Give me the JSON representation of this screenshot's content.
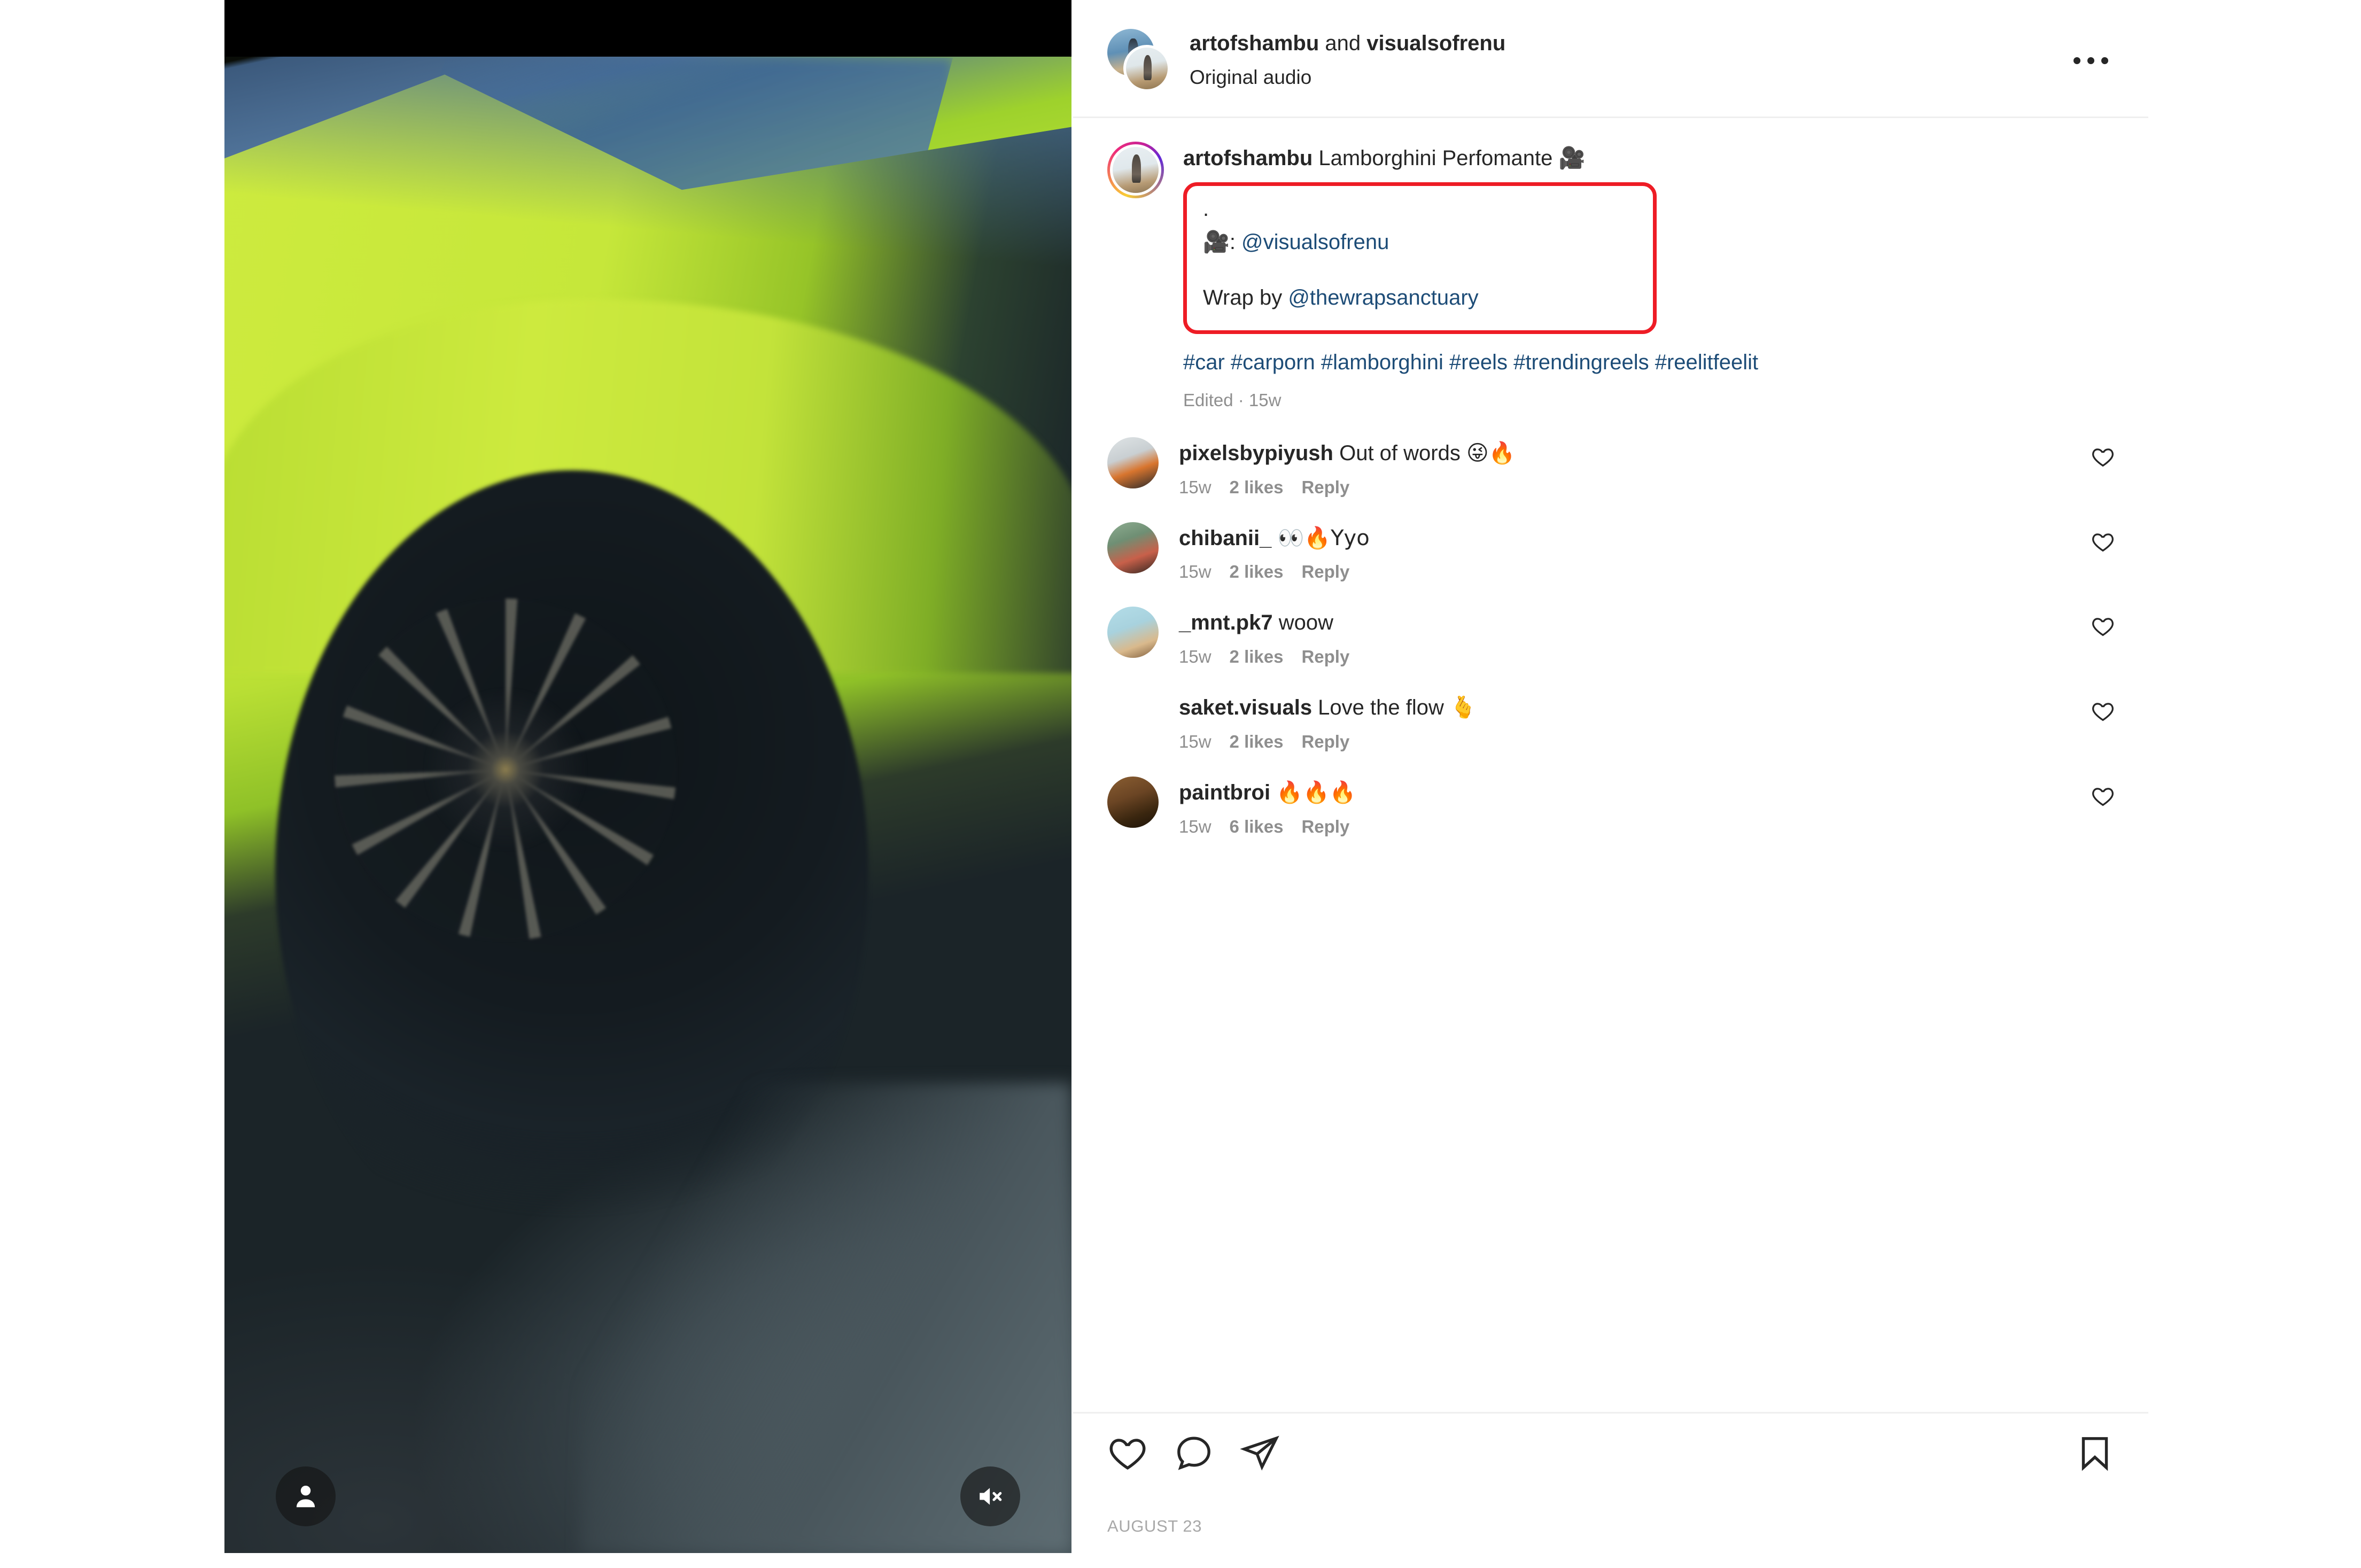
{
  "header": {
    "usernames": "artofshambu and visualsofrenu",
    "primary_user": "artofshambu",
    "secondary_user": "visualsofrenu",
    "connector": " and ",
    "audio": "Original audio",
    "more_icon": "more-options-icon"
  },
  "media": {
    "type": "video",
    "tag_icon": "person-tag-icon",
    "mute_icon": "speaker-muted-icon"
  },
  "caption": {
    "username": "artofshambu",
    "text": " Lamborghini Perfomante ",
    "emoji": "🎥",
    "boxed": {
      "dot": ".",
      "credit_emoji": "🎥",
      "credit_sep": ": ",
      "credit_mention": "@visualsofrenu",
      "wrap_prefix": "Wrap by ",
      "wrap_mention": "@thewrapsanctuary"
    },
    "hashtags": "#car #carporn #lamborghini #reels #trendingreels #reelitfeelit",
    "meta": "Edited · 15w",
    "annotation_color": "#ee1c25",
    "link_color": "#1d4c77"
  },
  "comments": [
    {
      "username": "pixelsbypiyush",
      "text": " Out of words ",
      "emoji": "😜🔥",
      "time": "15w",
      "likes": "2 likes",
      "reply": "Reply",
      "avatar_from": "#e8eaec",
      "avatar_to": "#d86b2a",
      "like_icon": "heart-icon"
    },
    {
      "username": "chibanii_",
      "text": " ",
      "emoji": "👀🔥Yyo",
      "time": "15w",
      "likes": "2 likes",
      "reply": "Reply",
      "avatar_from": "#7f9d86",
      "avatar_to": "#c8604a",
      "like_icon": "heart-icon"
    },
    {
      "username": "_mnt.pk7",
      "text": " woow",
      "emoji": "",
      "time": "15w",
      "likes": "2 likes",
      "reply": "Reply",
      "avatar_from": "#aedbe6",
      "avatar_to": "#d9b98c",
      "like_icon": "heart-icon"
    },
    {
      "username": "saket.visuals",
      "text": " Love the flow ",
      "emoji": "🫰",
      "time": "15w",
      "likes": "2 likes",
      "reply": "Reply",
      "avatar_from": "#e6cdb4",
      "avatar_to": "#8a6a4a",
      "like_icon": "heart-icon"
    },
    {
      "username": "paintbroi",
      "text": " ",
      "emoji": "🔥🔥🔥",
      "time": "15w",
      "likes": "6 likes",
      "reply": "Reply",
      "avatar_from": "#6e4a2a",
      "avatar_to": "#2a1c10",
      "like_icon": "heart-icon"
    }
  ],
  "actions": {
    "like_icon": "heart-icon",
    "comment_icon": "comment-bubble-icon",
    "share_icon": "share-paper-plane-icon",
    "save_icon": "bookmark-icon"
  },
  "footer": {
    "date": "AUGUST 23"
  }
}
